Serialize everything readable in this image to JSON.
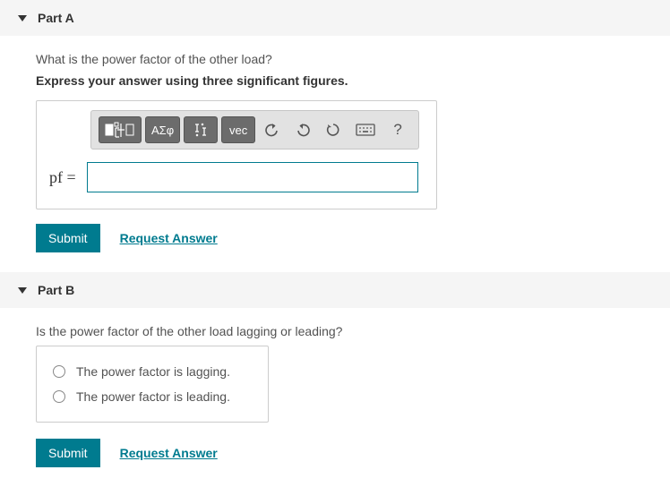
{
  "partA": {
    "title": "Part A",
    "question": "What is the power factor of the other load?",
    "instruction": "Express your answer using three significant figures.",
    "input_label": "pf =",
    "input_value": "",
    "toolbar": {
      "templates_label": "",
      "symbols_label": "ΑΣφ",
      "vec_label": "vec"
    },
    "submit_label": "Submit",
    "request_label": "Request Answer"
  },
  "partB": {
    "title": "Part B",
    "question": "Is the power factor of the other load lagging or leading?",
    "options": [
      "The power factor is lagging.",
      "The power factor is leading."
    ],
    "submit_label": "Submit",
    "request_label": "Request Answer"
  }
}
